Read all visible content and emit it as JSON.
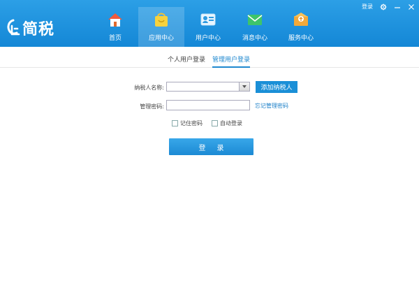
{
  "app": {
    "logo_text": "简税"
  },
  "top_right": {
    "login_label": "登录"
  },
  "nav": [
    {
      "label": "首页",
      "icon": "home-icon"
    },
    {
      "label": "应用中心",
      "icon": "shopping-bag-icon",
      "active": true
    },
    {
      "label": "用户中心",
      "icon": "user-card-icon"
    },
    {
      "label": "消息中心",
      "icon": "envelope-icon"
    },
    {
      "label": "服务中心",
      "icon": "service-envelope-icon"
    }
  ],
  "tabs": {
    "personal": "个人用户登录",
    "admin": "管理用户登录"
  },
  "form": {
    "taxpayer_label": "纳税人名称:",
    "taxpayer_value": "",
    "add_taxpayer_button": "添加纳税人",
    "password_label": "管理密码:",
    "password_value": "",
    "forgot_password": "忘记管理密码",
    "remember_password": "记住密码",
    "auto_login": "自动登录",
    "login_button": "登录"
  },
  "colors": {
    "header": "#1a8fd7",
    "accent": "#1f88cf",
    "button": "#1a8fd7"
  }
}
